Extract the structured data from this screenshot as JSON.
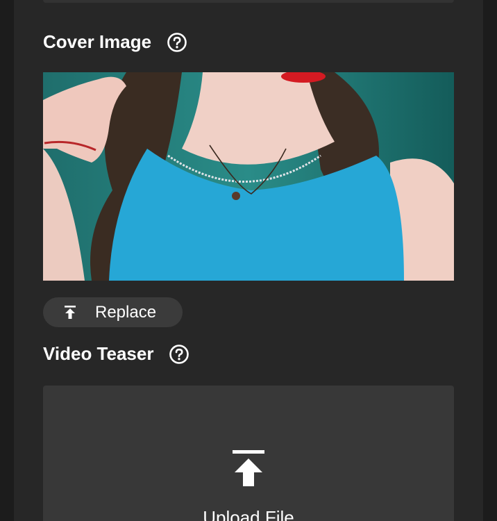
{
  "cover_image": {
    "heading": "Cover Image",
    "help_icon": "question-circle-icon",
    "replace_icon": "upload-arrow-icon",
    "replace_label": "Replace"
  },
  "video_teaser": {
    "heading": "Video Teaser",
    "help_icon": "question-circle-icon",
    "upload_icon": "upload-arrow-icon",
    "upload_label": "Upload File"
  },
  "colors": {
    "page_background": "#1c1c1c",
    "panel_background": "#272727",
    "button_background": "#3b3b3b",
    "dropzone_background": "#383838",
    "text": "#ffffff"
  }
}
